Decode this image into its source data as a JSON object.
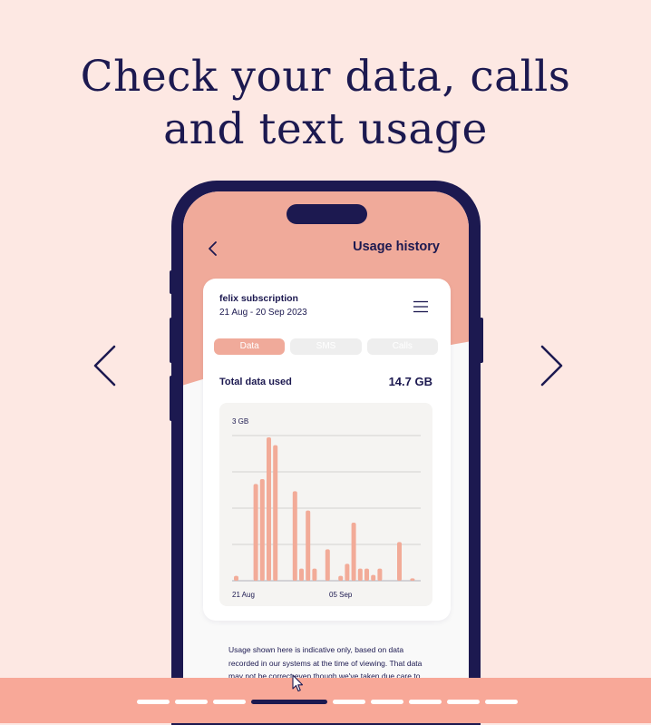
{
  "headline": {
    "line1": "Check your data, calls",
    "line2": "and text usage"
  },
  "carousel": {
    "prev_icon": "chevron-left-icon",
    "next_icon": "chevron-right-icon",
    "slide_count": 9,
    "active_index": 3
  },
  "colors": {
    "background": "#fde8e3",
    "navy": "#1c1950",
    "salmon": "#f0aa9a",
    "bar_color": "#f2ab98",
    "bottom_bar": "#f8a898"
  },
  "screen": {
    "back_icon": "chevron-left-icon",
    "title": "Usage history",
    "card": {
      "subscription_name": "felix subscription",
      "date_range": "21 Aug - 20 Sep 2023",
      "menu_icon": "menu-icon",
      "tabs": [
        {
          "label": "Data",
          "active": true
        },
        {
          "label": "SMS",
          "active": false
        },
        {
          "label": "Calls",
          "active": false
        }
      ],
      "total_label": "Total data used",
      "total_value": "14.7 GB"
    },
    "disclaimer": "Usage shown here is indicative only, based on data recorded in our systems at the time of viewing. That data may not be correct even though we've taken due care to"
  },
  "chart_data": {
    "type": "bar",
    "y_tick_label": "3 GB",
    "ylim": [
      0,
      3
    ],
    "grid": true,
    "x_tick_labels": [
      "21 Aug",
      "05 Sep"
    ],
    "categories": [
      "21 Aug",
      "22 Aug",
      "23 Aug",
      "24 Aug",
      "25 Aug",
      "26 Aug",
      "27 Aug",
      "28 Aug",
      "29 Aug",
      "30 Aug",
      "31 Aug",
      "01 Sep",
      "02 Sep",
      "03 Sep",
      "04 Sep",
      "05 Sep",
      "06 Sep",
      "07 Sep",
      "08 Sep",
      "09 Sep",
      "10 Sep",
      "11 Sep",
      "12 Sep",
      "13 Sep",
      "14 Sep",
      "15 Sep",
      "16 Sep",
      "17 Sep",
      "18 Sep",
      "19 Sep",
      "20 Sep"
    ],
    "values": [
      0.1,
      0,
      0,
      2.0,
      2.1,
      3.2,
      2.8,
      0,
      0,
      1.85,
      0.25,
      1.45,
      0.25,
      0,
      0.65,
      0,
      0.1,
      0.35,
      1.2,
      0.25,
      0.25,
      0.12,
      0.25,
      0,
      0,
      0.8,
      0,
      0.05,
      0,
      0,
      0
    ]
  }
}
